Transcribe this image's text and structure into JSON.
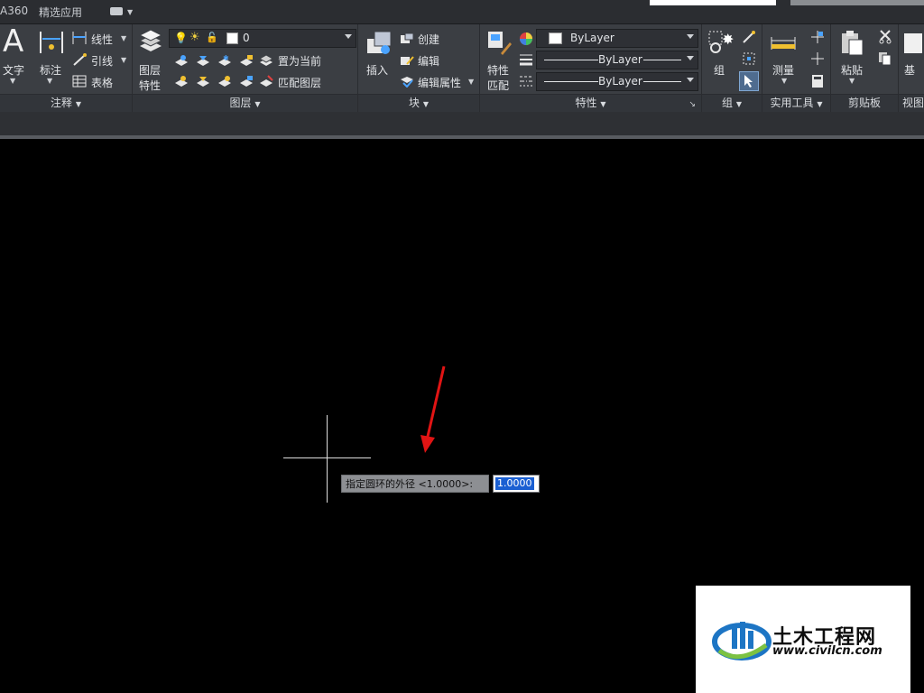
{
  "tabs": {
    "a360": "A360",
    "featured": "精选应用"
  },
  "ribbon": {
    "annotation": {
      "title": "注释",
      "text_label": "文字",
      "dimension_label": "标注",
      "linear_label": "线性",
      "leader_label": "引线",
      "table_label": "表格"
    },
    "layers": {
      "title": "图层",
      "properties_label": "图层\n特性",
      "properties_line1": "图层",
      "properties_line2": "特性",
      "current_layer": "0",
      "set_current_label": "置为当前",
      "match_layer_label": "匹配图层"
    },
    "block": {
      "title": "块",
      "insert_label": "插入",
      "create_label": "创建",
      "edit_label": "编辑",
      "edit_attributes_label": "编辑属性"
    },
    "properties": {
      "title": "特性",
      "match_line1": "特性",
      "match_line2": "匹配",
      "color_value": "ByLayer",
      "linetype_value": "ByLayer",
      "lineweight_value": "ByLayer"
    },
    "group": {
      "title": "组",
      "group_label": "组"
    },
    "utilities": {
      "title": "实用工具",
      "measure_label": "测量"
    },
    "clipboard": {
      "title": "剪贴板",
      "paste_label": "粘贴"
    },
    "view": {
      "title": "视图",
      "base_label": "基"
    }
  },
  "command": {
    "prompt": "指定圆环的外径 <1.0000>:",
    "value": "1.0000"
  },
  "watermark": {
    "name": "土木工程网",
    "url": "www.civilcn.com"
  },
  "colors": {
    "ribbon_bg": "#3b3e43",
    "canvas_bg": "#000000",
    "selection": "#1a5fd2",
    "arrow": "#e11414"
  }
}
